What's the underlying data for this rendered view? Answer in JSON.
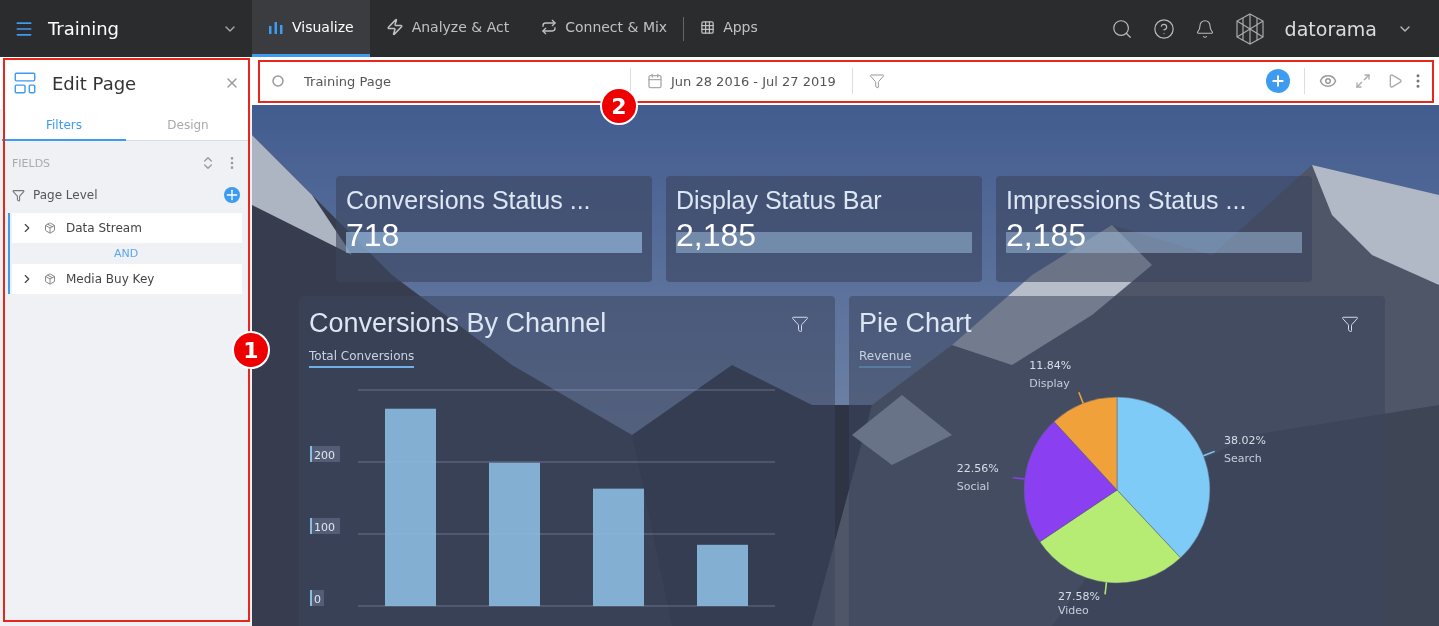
{
  "top_nav": {
    "workspace": "Training",
    "tabs": [
      {
        "label": "Visualize",
        "selected": true
      },
      {
        "label": "Analyze & Act",
        "selected": false
      },
      {
        "label": "Connect & Mix",
        "selected": false
      },
      {
        "label": "Apps",
        "selected": false
      }
    ],
    "brand": "datorama"
  },
  "edit_panel": {
    "title": "Edit Page",
    "tabs": [
      {
        "label": "Filters",
        "selected": true
      },
      {
        "label": "Design",
        "selected": false
      }
    ],
    "section_label": "FIELDS",
    "filter_group": {
      "label": "Page Level",
      "operator": "AND",
      "items": [
        {
          "label": "Data Stream",
          "expanded": false
        },
        {
          "label": "Media Buy Key",
          "expanded": false
        }
      ]
    }
  },
  "page_toolbar": {
    "page_name": "Training Page",
    "date_range": "Jun 28 2016 - Jul 27 2019"
  },
  "kpi_widgets": [
    {
      "title": "Conversions Status ...",
      "value": "718",
      "level": 1
    },
    {
      "title": "Display Status Bar",
      "value": "2,185",
      "level": 1
    },
    {
      "title": "Impressions Status ...",
      "value": "2,185",
      "level": 1
    }
  ],
  "charts": [
    {
      "title": "Conversions By Channel",
      "metric": "Total Conversions",
      "chart_data": {
        "type": "bar",
        "ylim": [
          0,
          300
        ],
        "yticks": [
          0,
          100,
          200
        ],
        "series": [
          {
            "color": "#8bbbe0",
            "values": [
              274,
              199,
              163,
              85
            ]
          }
        ]
      }
    },
    {
      "title": "Pie Chart",
      "metric": "Revenue",
      "chart_data": {
        "type": "pie",
        "categories": [
          "Search",
          "Video",
          "Social",
          "Display"
        ],
        "values": [
          38.02,
          27.58,
          22.56,
          11.84
        ],
        "colors": [
          "#7ecbf8",
          "#b6ec74",
          "#8a3ff0",
          "#f0a13a"
        ],
        "value_labels": [
          "38.02%",
          "27.58%",
          "22.56%",
          "11.84%"
        ]
      }
    }
  ],
  "callouts": [
    {
      "number": "1"
    },
    {
      "number": "2"
    }
  ]
}
